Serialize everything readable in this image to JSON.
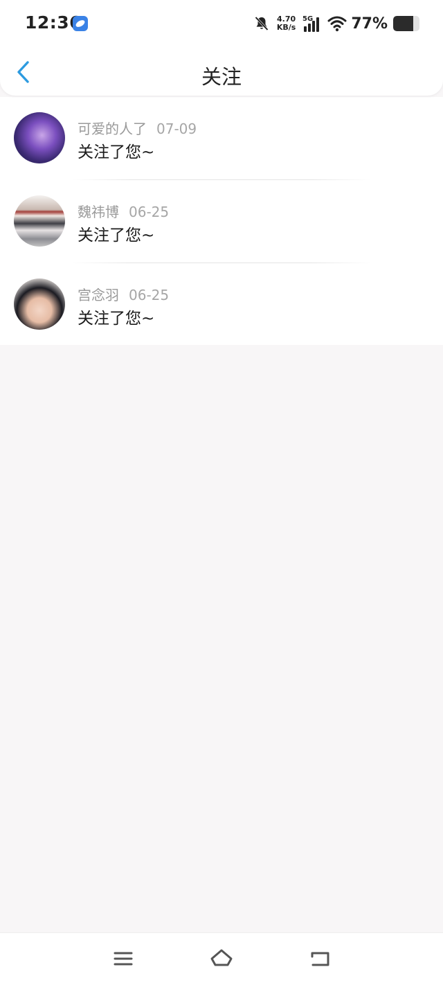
{
  "status_bar": {
    "time": "12:36",
    "net_speed_value": "4.70",
    "net_speed_unit": "KB/s",
    "network_type": "5G",
    "battery_percent": "77%",
    "battery_level": 0.77,
    "icons": [
      "app-badge-icon",
      "bell-muted-icon",
      "signal-icon",
      "wifi-icon",
      "battery-icon"
    ]
  },
  "nav": {
    "title": "关注",
    "back_icon": "chevron-left-icon",
    "accent_color": "#2d9be0"
  },
  "notifications": [
    {
      "name": "可爱的人了",
      "date": "07-09",
      "message": "关注了您~"
    },
    {
      "name": "魏祎博",
      "date": "06-25",
      "message": "关注了您~"
    },
    {
      "name": "宫念羽",
      "date": "06-25",
      "message": "关注了您~"
    }
  ],
  "system_nav": {
    "icons": [
      "menu-icon",
      "home-icon",
      "back-icon"
    ]
  }
}
